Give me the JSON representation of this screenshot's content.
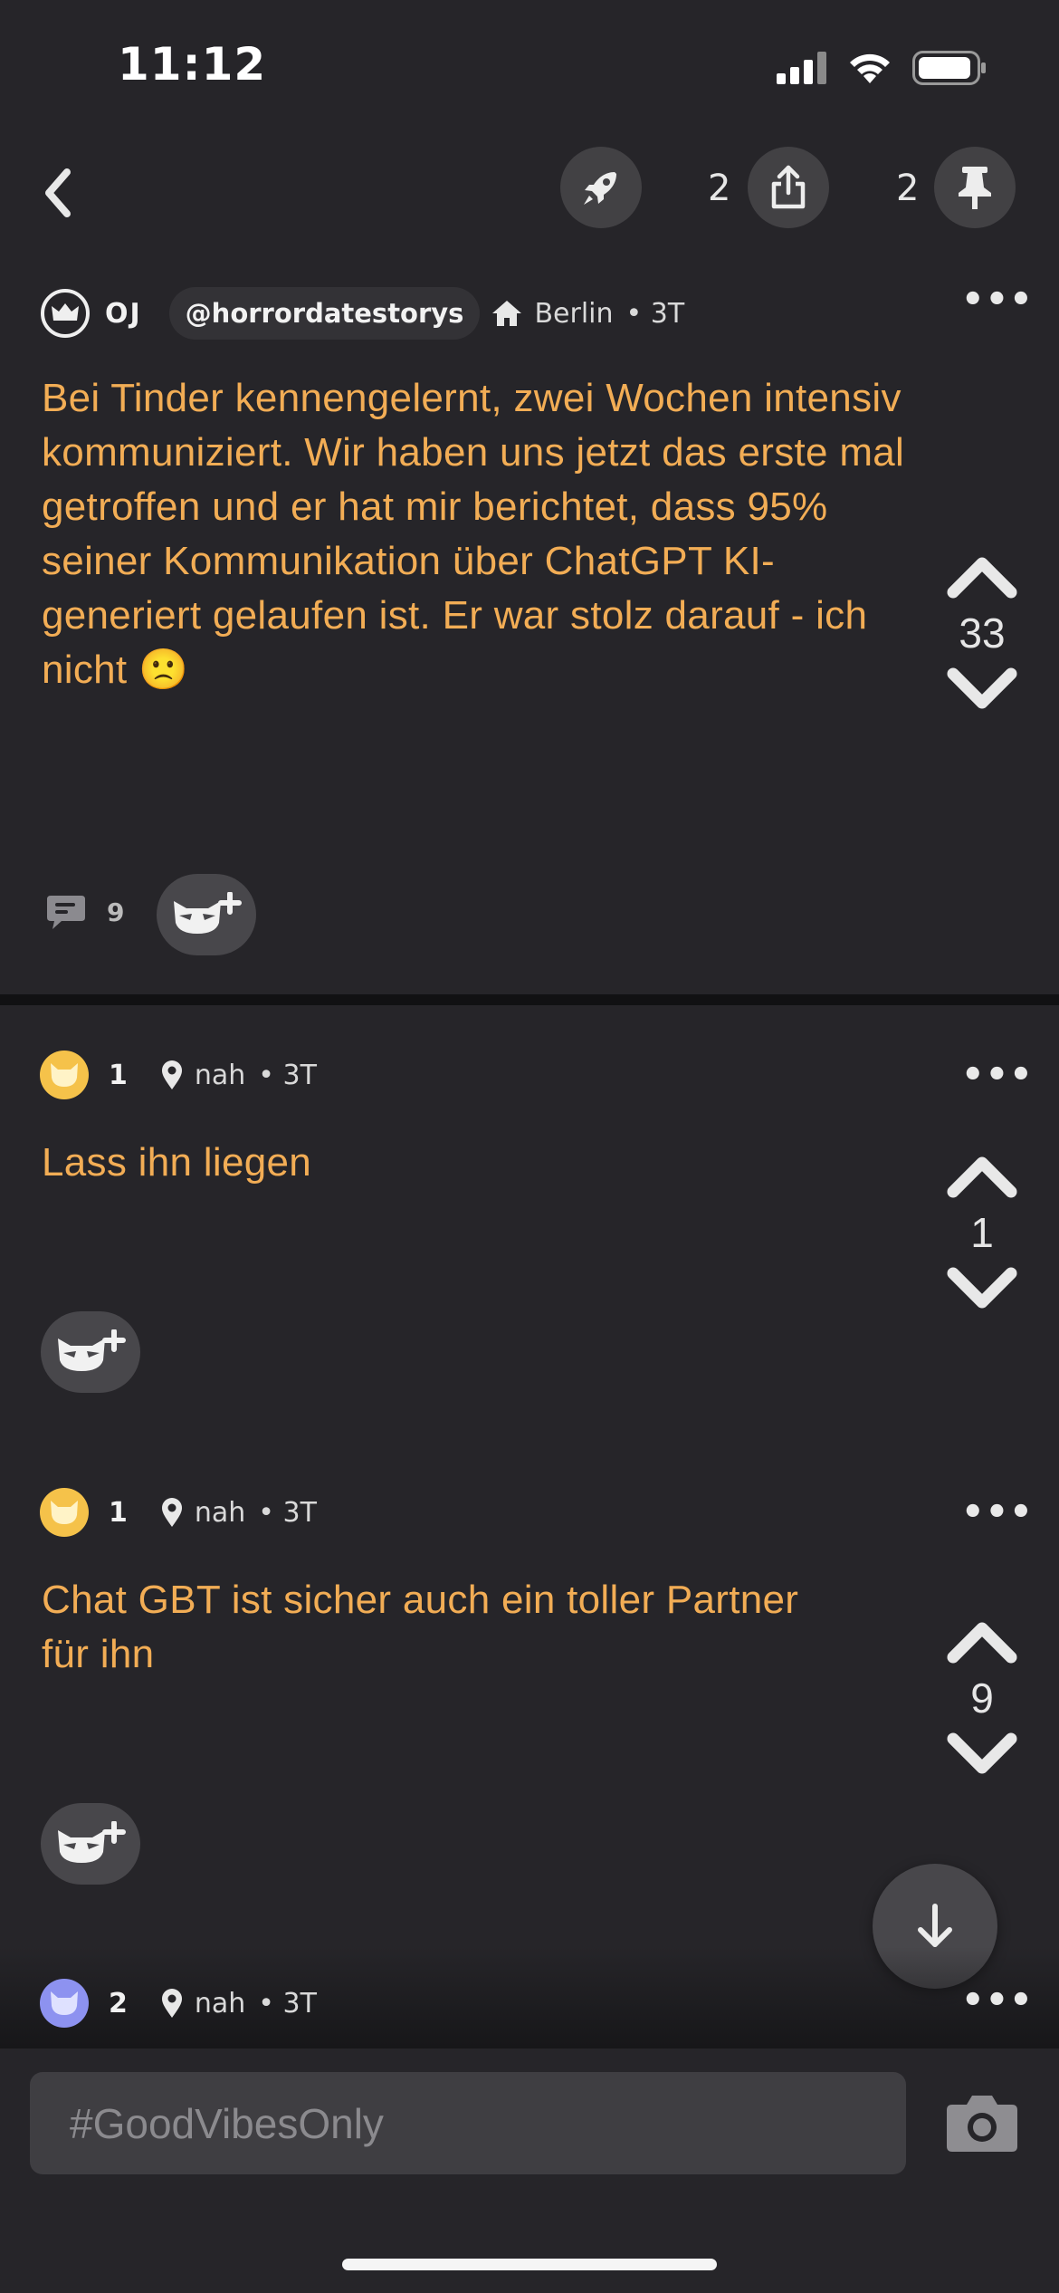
{
  "status_bar": {
    "time": "11:12"
  },
  "header": {
    "share_count": "2",
    "pin_count": "2"
  },
  "post": {
    "author": "OJ",
    "handle": "@horrordatestorys",
    "location": "Berlin",
    "age": "• 3T",
    "text": "Bei Tinder kennengelernt, zwei Wochen intensiv kommuniziert. Wir haben uns jetzt das erste mal getroffen und er hat mir berichtet, dass 95% seiner Kommunikation über ChatGPT KI-generiert gelaufen ist. Er war stolz darauf - ich nicht 🙁",
    "votes": "33",
    "comment_count": "9"
  },
  "comments": [
    {
      "number": "1",
      "location": "nah",
      "age": "• 3T",
      "text": "Lass ihn liegen",
      "votes": "1",
      "avatar_color": "#f5c24a"
    },
    {
      "number": "1",
      "location": "nah",
      "age": "• 3T",
      "text": "Chat GBT ist sicher auch ein toller Partner für ihn",
      "votes": "9",
      "avatar_color": "#f5c24a"
    },
    {
      "number": "2",
      "location": "nah",
      "age": "• 3T",
      "avatar_color": "#8d92f0"
    }
  ],
  "input": {
    "placeholder": "#GoodVibesOnly"
  },
  "colors": {
    "accent": "#f2ad55",
    "background": "#262529"
  }
}
